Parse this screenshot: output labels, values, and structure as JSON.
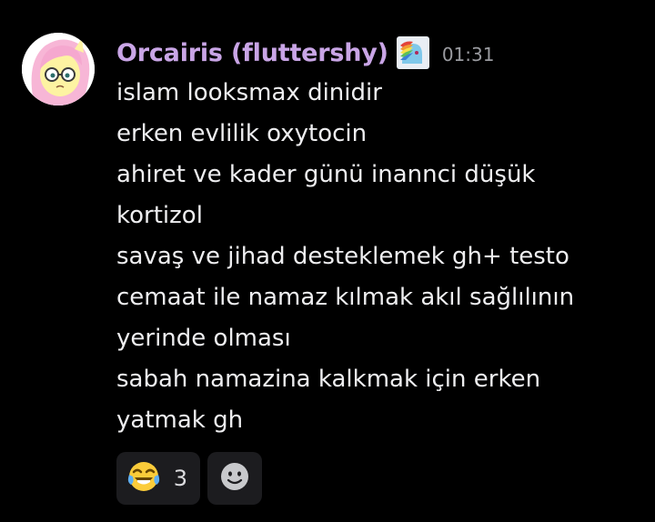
{
  "message": {
    "author": "Orcairis (fluttershy)",
    "timestamp": "01:31",
    "avatar_icon": "fluttershy-avatar",
    "role_icon": "rainbow-dash-role-icon",
    "lines": [
      "islam looksmax dinidir",
      "erken evlilik oxytocin",
      "ahiret ve kader günü inannci düşük",
      "kortizol",
      "savaş ve jihad desteklemek gh+ testo",
      "cemaat ile namaz kılmak akıl sağlılının",
      "yerinde olması",
      "sabah namazina kalkmak için erken",
      "yatmak gh"
    ]
  },
  "reactions": [
    {
      "emoji": "😂",
      "icon": "joy-tears-icon",
      "count": "3"
    }
  ],
  "add_reaction_icon": "smiley-add-reaction-icon",
  "colors": {
    "background": "#000000",
    "username": "#c9a5e6",
    "text": "#eeeef0",
    "timestamp": "#9a9ba0",
    "reaction_bg": "#1c1c1f"
  }
}
